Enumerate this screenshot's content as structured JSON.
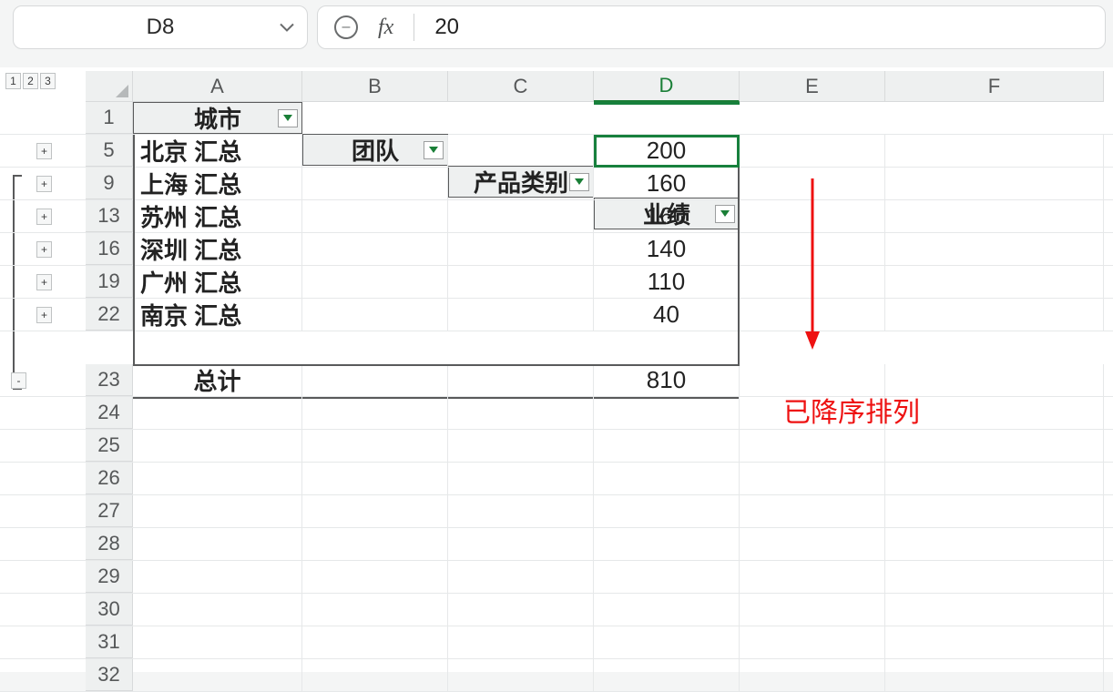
{
  "formula_bar": {
    "cell_ref": "D8",
    "fx_symbol": "fx",
    "value": "20"
  },
  "outline": {
    "levels": [
      "1",
      "2",
      "3"
    ],
    "expand_symbol": "+",
    "collapse_symbol": "-"
  },
  "columns": {
    "A": "A",
    "B": "B",
    "C": "C",
    "D": "D",
    "E": "E",
    "F": "F"
  },
  "header_row": {
    "row_num": "1",
    "A": "城市",
    "B": "团队",
    "C": "产品类别",
    "D": "业绩"
  },
  "data_rows": [
    {
      "row_num": "5",
      "city": "北京 汇总",
      "value": "200"
    },
    {
      "row_num": "9",
      "city": "上海 汇总",
      "value": "160"
    },
    {
      "row_num": "13",
      "city": "苏州 汇总",
      "value": "160"
    },
    {
      "row_num": "16",
      "city": "深圳 汇总",
      "value": "140"
    },
    {
      "row_num": "19",
      "city": "广州 汇总",
      "value": "110"
    },
    {
      "row_num": "22",
      "city": "南京 汇总",
      "value": "40"
    }
  ],
  "total_row": {
    "row_num": "23",
    "label": "总计",
    "value": "810"
  },
  "empty_row_nums": [
    "24",
    "25",
    "26",
    "27",
    "28",
    "29",
    "30",
    "31",
    "32"
  ],
  "annotation": {
    "text": "已降序排列"
  }
}
